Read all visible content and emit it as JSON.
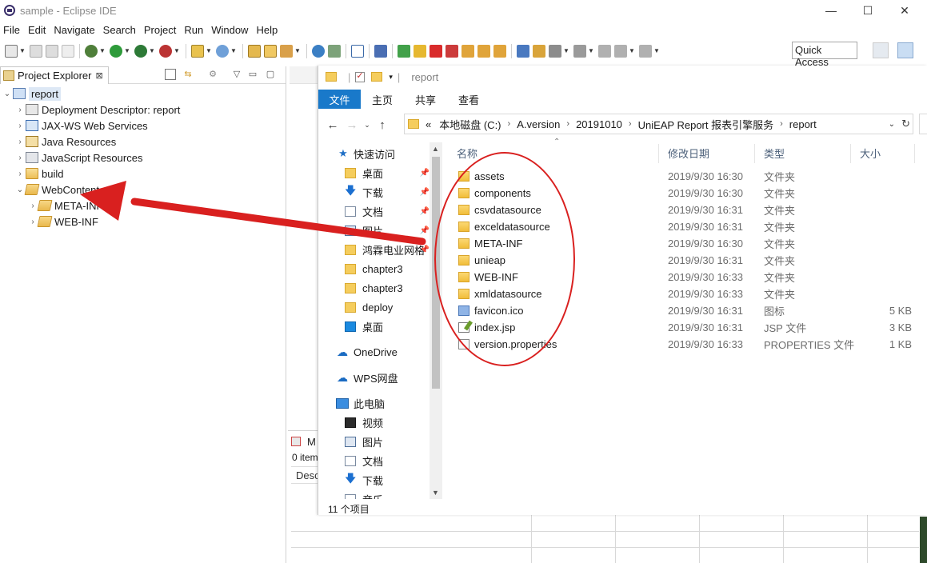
{
  "window": {
    "title": "sample - Eclipse IDE",
    "controls": {
      "minimize": "—",
      "maximize": "☐",
      "close": "✕"
    }
  },
  "menu": [
    "File",
    "Edit",
    "Navigate",
    "Search",
    "Project",
    "Run",
    "Window",
    "Help"
  ],
  "toolbar": {
    "quick_access": "Quick Access"
  },
  "project_explorer": {
    "tab_label": "Project Explorer",
    "tab_close": "⊠",
    "tree": [
      {
        "label": "report",
        "level": 0,
        "expanded": true,
        "icon": "project-icon",
        "selected": true
      },
      {
        "label": "Deployment Descriptor: report",
        "level": 1,
        "expanded": false,
        "icon": "descriptor-icon"
      },
      {
        "label": "JAX-WS Web Services",
        "level": 1,
        "expanded": false,
        "icon": "webservice-icon"
      },
      {
        "label": "Java Resources",
        "level": 1,
        "expanded": false,
        "icon": "java-resources-icon"
      },
      {
        "label": "JavaScript Resources",
        "level": 1,
        "expanded": false,
        "icon": "javascript-resources-icon"
      },
      {
        "label": "build",
        "level": 1,
        "expanded": false,
        "icon": "folder-icon"
      },
      {
        "label": "WebContent",
        "level": 1,
        "expanded": true,
        "icon": "folder-open-icon"
      },
      {
        "label": "META-INF",
        "level": 2,
        "expanded": false,
        "icon": "folder-icon"
      },
      {
        "label": "WEB-INF",
        "level": 2,
        "expanded": false,
        "icon": "folder-icon"
      }
    ]
  },
  "eclipse_bottom": {
    "tab_label": "M",
    "count_text": "0 item",
    "column_label": "Desc"
  },
  "file_explorer": {
    "qat_title": "report",
    "ribbon_tabs": [
      "文件",
      "主页",
      "共享",
      "查看"
    ],
    "address": {
      "prefix": "«",
      "crumbs": [
        "本地磁盘 (C:)",
        "A.version",
        "20191010",
        "UniEAP Report 报表引擎服务",
        "report"
      ]
    },
    "nav_pane": [
      {
        "label": "快速访问",
        "icon": "star-icon",
        "pinned": false
      },
      {
        "label": "桌面",
        "icon": "folder-icon",
        "pinned": true
      },
      {
        "label": "下载",
        "icon": "download-icon",
        "pinned": true
      },
      {
        "label": "文档",
        "icon": "document-icon",
        "pinned": true
      },
      {
        "label": "图片",
        "icon": "picture-icon",
        "pinned": true
      },
      {
        "label": "鸿霖电业网格",
        "icon": "folder-icon",
        "pinned": true
      },
      {
        "label": "chapter3",
        "icon": "folder-icon",
        "pinned": false
      },
      {
        "label": "chapter3",
        "icon": "folder-icon",
        "pinned": false
      },
      {
        "label": "deploy",
        "icon": "folder-icon",
        "pinned": false
      },
      {
        "label": "桌面",
        "icon": "desktop-icon",
        "pinned": false
      },
      {
        "label": "OneDrive",
        "icon": "cloud-icon",
        "pinned": false
      },
      {
        "label": "WPS网盘",
        "icon": "cloud-icon",
        "pinned": false
      },
      {
        "label": "此电脑",
        "icon": "computer-icon",
        "pinned": false
      },
      {
        "label": "视频",
        "icon": "video-icon",
        "pinned": false
      },
      {
        "label": "图片",
        "icon": "picture-icon",
        "pinned": false
      },
      {
        "label": "文档",
        "icon": "document-icon",
        "pinned": false
      },
      {
        "label": "下载",
        "icon": "download-icon",
        "pinned": false
      },
      {
        "label": "音乐",
        "icon": "music-icon",
        "pinned": false
      }
    ],
    "columns": {
      "name": "名称",
      "date": "修改日期",
      "type": "类型",
      "size": "大小"
    },
    "files": [
      {
        "name": "assets",
        "date": "2019/9/30 16:30",
        "type": "文件夹",
        "size": "",
        "icon": "folder-icon"
      },
      {
        "name": "components",
        "date": "2019/9/30 16:30",
        "type": "文件夹",
        "size": "",
        "icon": "folder-icon"
      },
      {
        "name": "csvdatasource",
        "date": "2019/9/30 16:31",
        "type": "文件夹",
        "size": "",
        "icon": "folder-icon"
      },
      {
        "name": "exceldatasource",
        "date": "2019/9/30 16:31",
        "type": "文件夹",
        "size": "",
        "icon": "folder-icon"
      },
      {
        "name": "META-INF",
        "date": "2019/9/30 16:30",
        "type": "文件夹",
        "size": "",
        "icon": "folder-icon"
      },
      {
        "name": "unieap",
        "date": "2019/9/30 16:31",
        "type": "文件夹",
        "size": "",
        "icon": "folder-icon"
      },
      {
        "name": "WEB-INF",
        "date": "2019/9/30 16:33",
        "type": "文件夹",
        "size": "",
        "icon": "folder-icon"
      },
      {
        "name": "xmldatasource",
        "date": "2019/9/30 16:33",
        "type": "文件夹",
        "size": "",
        "icon": "folder-icon"
      },
      {
        "name": "favicon.ico",
        "date": "2019/9/30 16:31",
        "type": "图标",
        "size": "5 KB",
        "icon": "ico-file-icon"
      },
      {
        "name": "index.jsp",
        "date": "2019/9/30 16:31",
        "type": "JSP 文件",
        "size": "3 KB",
        "icon": "jsp-file-icon"
      },
      {
        "name": "version.properties",
        "date": "2019/9/30 16:33",
        "type": "PROPERTIES 文件",
        "size": "1 KB",
        "icon": "properties-file-icon"
      }
    ],
    "status": "11 个项目"
  },
  "annotation_colors": {
    "red": "#d9201f"
  }
}
